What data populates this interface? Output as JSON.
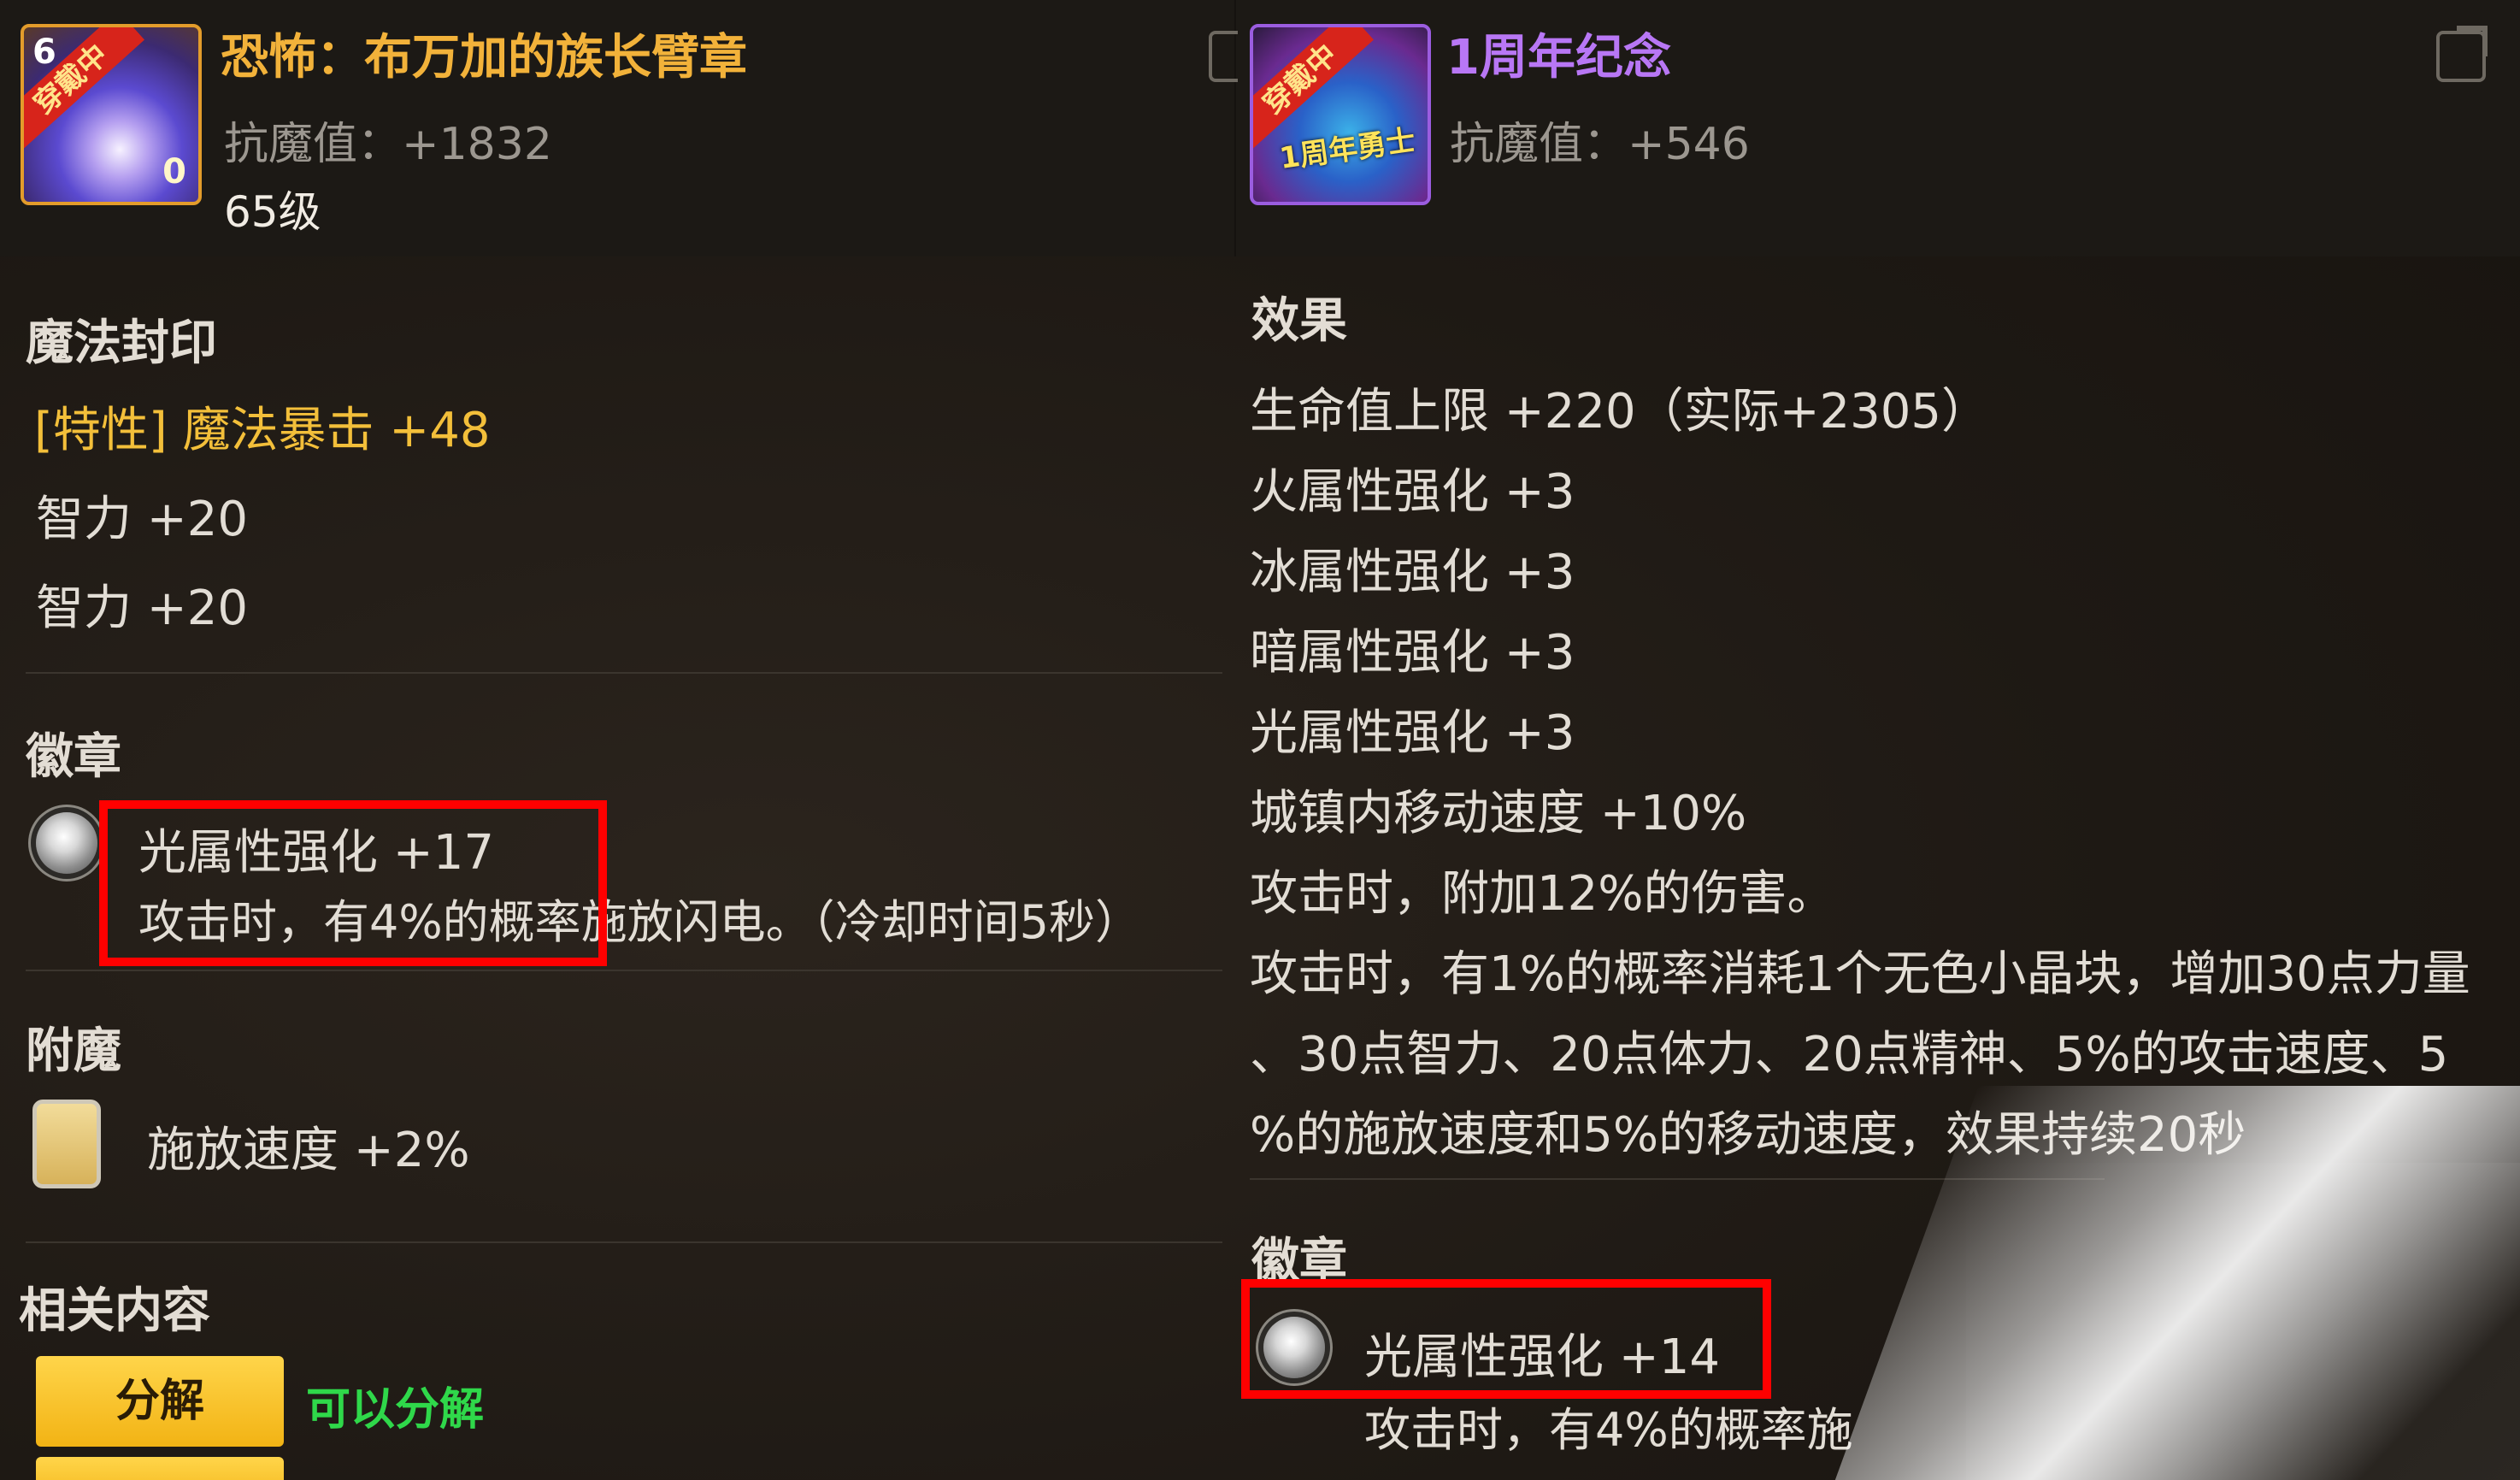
{
  "left_item": {
    "title": "恐怖：布万加的族长臂章",
    "stat": "抗魔值：+1832",
    "level": "65级",
    "icon_ribbon": "穿戴中",
    "icon_corner": "6",
    "icon_badge": "0"
  },
  "right_item": {
    "title": "1周年纪念",
    "stat": "抗魔值：+546",
    "icon_ribbon": "穿戴中",
    "icon_text": "1周年勇士"
  },
  "left_panel": {
    "seal_title": "魔法封印",
    "seal_lines": [
      "[特性] 魔法暴击 +48",
      "智力 +20",
      "智力 +20"
    ],
    "badge_title": "徽章",
    "badge_line1": "光属性强化 +17",
    "badge_line2": "攻击时，有4%的概率施放闪电。（冷却时间5秒）",
    "enchant_title": "附魔",
    "enchant_line": "施放速度 +2%",
    "related_title": "相关内容",
    "decompose_button": "分解",
    "decompose_status": "可以分解"
  },
  "right_panel": {
    "effect_title": "效果",
    "effect_lines": [
      "生命值上限 +220（实际+2305）",
      "火属性强化 +3",
      "冰属性强化 +3",
      "暗属性强化 +3",
      "光属性强化 +3",
      "城镇内移动速度 +10%",
      "攻击时，附加12%的伤害。",
      "攻击时，有1%的概率消耗1个无色小晶块，增加30点力量",
      "、30点智力、20点体力、20点精神、5%的攻击速度、5",
      "%的施放速度和5%的移动速度，效果持续20秒"
    ],
    "badge_title": "徽章",
    "badge_line1": "光属性强化 +14",
    "badge_line2": "攻击时，有4%的概率施"
  },
  "colors": {
    "title_gold": "#f2b23a",
    "title_purple": "#b877f5",
    "highlight_red": "#ff0000",
    "status_green": "#2fd84a",
    "button_yellow": "#f2b314"
  }
}
